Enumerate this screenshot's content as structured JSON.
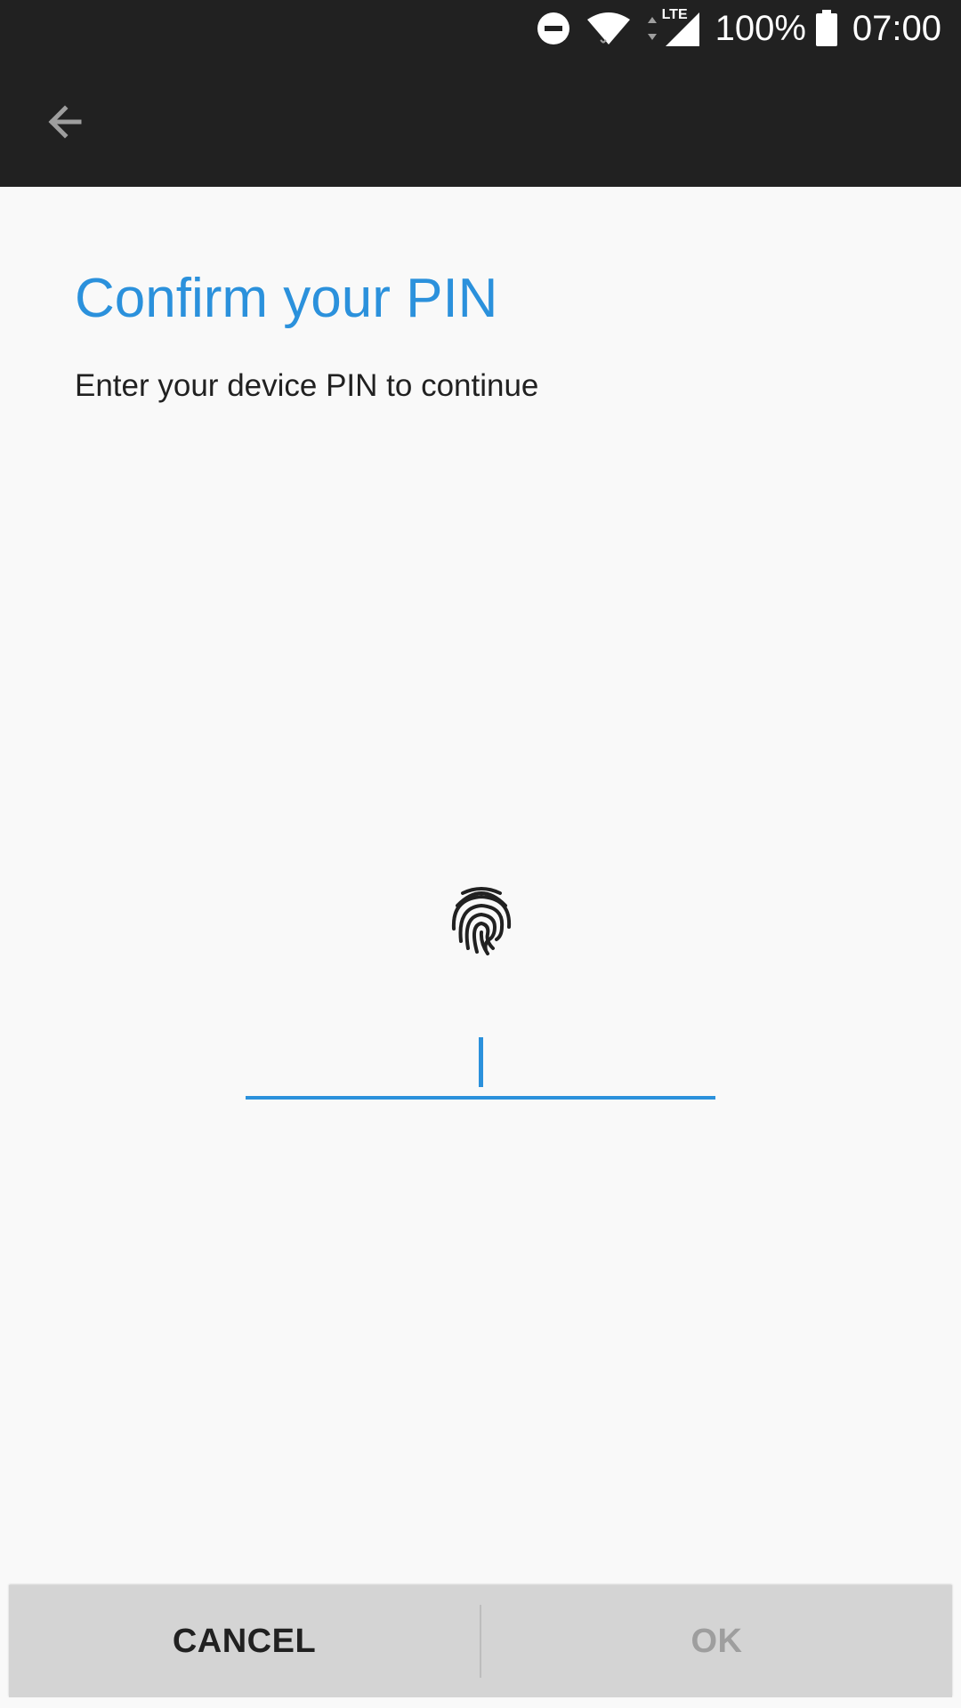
{
  "status_bar": {
    "icons": [
      "do-not-disturb-icon",
      "wifi-icon",
      "lte-signal-icon",
      "battery-icon"
    ],
    "network_label": "LTE",
    "battery": "100%",
    "time": "07:00"
  },
  "app_bar": {
    "back_icon": "arrow-back-icon"
  },
  "content": {
    "title": "Confirm your PIN",
    "subtitle": "Enter your device PIN to continue",
    "fingerprint_icon": "fingerprint-icon",
    "pin_value": ""
  },
  "buttons": {
    "cancel_label": "CANCEL",
    "ok_label": "OK"
  },
  "colors": {
    "accent": "#2b91dc",
    "bar_background": "#212121",
    "page_background": "#f9f9f9",
    "button_bar": "#d4d4d4",
    "disabled_text": "#9e9e9e"
  }
}
